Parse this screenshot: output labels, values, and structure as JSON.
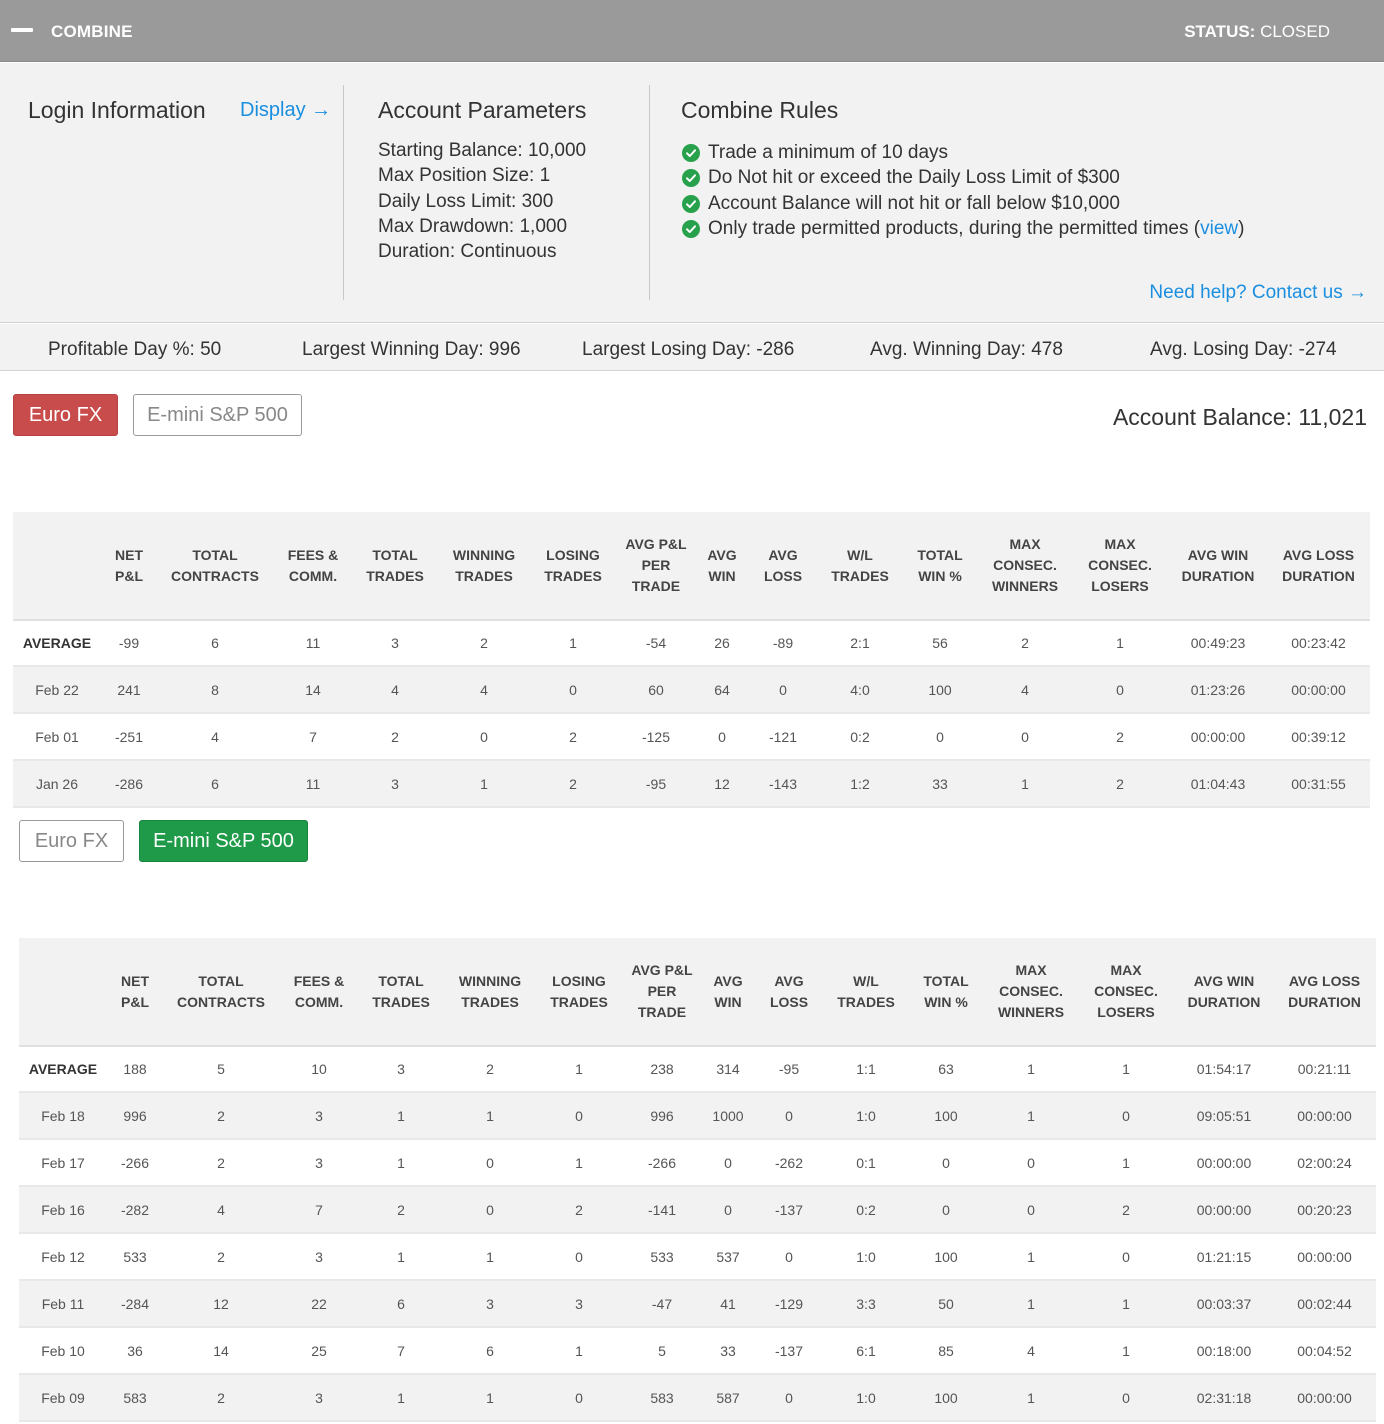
{
  "header": {
    "title": "COMBINE",
    "status_label": "STATUS:",
    "status_value": "CLOSED"
  },
  "login": {
    "title": "Login Information",
    "display_link": "Display →"
  },
  "account_parameters": {
    "title": "Account Parameters",
    "items": [
      "Starting Balance: 10,000",
      "Max Position Size: 1",
      "Daily Loss Limit: 300",
      "Max Drawdown: 1,000",
      "Duration: Continuous"
    ]
  },
  "combine_rules": {
    "title": "Combine Rules",
    "rules": [
      "Trade a minimum of 10 days",
      "Do Not hit or exceed the Daily Loss Limit of $300",
      "Account Balance will not hit or fall below $10,000"
    ],
    "rule_last_prefix": "Only trade permitted products, during the permitted times (",
    "rule_last_link": "view",
    "rule_last_suffix": ")",
    "help_link": "Need help? Contact us →"
  },
  "summary_stats": [
    "Profitable Day %: 50",
    "Largest Winning Day: 996",
    "Largest Losing Day: -286",
    "Avg. Winning Day: 478",
    "Avg. Losing Day: -274"
  ],
  "account_balance": "Account Balance: 11,021",
  "products": {
    "euro": "Euro FX",
    "emini": "E-mini S&P 500"
  },
  "table_headers": [
    "",
    "NET P&L",
    "TOTAL CONTRACTS",
    "FEES & COMM.",
    "TOTAL TRADES",
    "WINNING TRADES",
    "LOSING TRADES",
    "AVG P&L PER TRADE",
    "AVG WIN",
    "AVG LOSS",
    "W/L TRADES",
    "TOTAL WIN %",
    "MAX CONSEC. WINNERS",
    "MAX CONSEC. LOSERS",
    "AVG WIN DURATION",
    "AVG LOSS DURATION"
  ],
  "euro_table": [
    [
      "AVERAGE",
      "-99",
      "6",
      "11",
      "3",
      "2",
      "1",
      "-54",
      "26",
      "-89",
      "2:1",
      "56",
      "2",
      "1",
      "00:49:23",
      "00:23:42"
    ],
    [
      "Feb 22",
      "241",
      "8",
      "14",
      "4",
      "4",
      "0",
      "60",
      "64",
      "0",
      "4:0",
      "100",
      "4",
      "0",
      "01:23:26",
      "00:00:00"
    ],
    [
      "Feb 01",
      "-251",
      "4",
      "7",
      "2",
      "0",
      "2",
      "-125",
      "0",
      "-121",
      "0:2",
      "0",
      "0",
      "2",
      "00:00:00",
      "00:39:12"
    ],
    [
      "Jan 26",
      "-286",
      "6",
      "11",
      "3",
      "1",
      "2",
      "-95",
      "12",
      "-143",
      "1:2",
      "33",
      "1",
      "2",
      "01:04:43",
      "00:31:55"
    ]
  ],
  "emini_table": [
    [
      "AVERAGE",
      "188",
      "5",
      "10",
      "3",
      "2",
      "1",
      "238",
      "314",
      "-95",
      "1:1",
      "63",
      "1",
      "1",
      "01:54:17",
      "00:21:11"
    ],
    [
      "Feb 18",
      "996",
      "2",
      "3",
      "1",
      "1",
      "0",
      "996",
      "1000",
      "0",
      "1:0",
      "100",
      "1",
      "0",
      "09:05:51",
      "00:00:00"
    ],
    [
      "Feb 17",
      "-266",
      "2",
      "3",
      "1",
      "0",
      "1",
      "-266",
      "0",
      "-262",
      "0:1",
      "0",
      "0",
      "1",
      "00:00:00",
      "02:00:24"
    ],
    [
      "Feb 16",
      "-282",
      "4",
      "7",
      "2",
      "0",
      "2",
      "-141",
      "0",
      "-137",
      "0:2",
      "0",
      "0",
      "2",
      "00:00:00",
      "00:20:23"
    ],
    [
      "Feb 12",
      "533",
      "2",
      "3",
      "1",
      "1",
      "0",
      "533",
      "537",
      "0",
      "1:0",
      "100",
      "1",
      "0",
      "01:21:15",
      "00:00:00"
    ],
    [
      "Feb 11",
      "-284",
      "12",
      "22",
      "6",
      "3",
      "3",
      "-47",
      "41",
      "-129",
      "3:3",
      "50",
      "1",
      "1",
      "00:03:37",
      "00:02:44"
    ],
    [
      "Feb 10",
      "36",
      "14",
      "25",
      "7",
      "6",
      "1",
      "5",
      "33",
      "-137",
      "6:1",
      "85",
      "4",
      "1",
      "00:18:00",
      "00:04:52"
    ],
    [
      "Feb 09",
      "583",
      "2",
      "3",
      "1",
      "1",
      "0",
      "583",
      "587",
      "0",
      "1:0",
      "100",
      "1",
      "0",
      "02:31:18",
      "00:00:00"
    ]
  ]
}
